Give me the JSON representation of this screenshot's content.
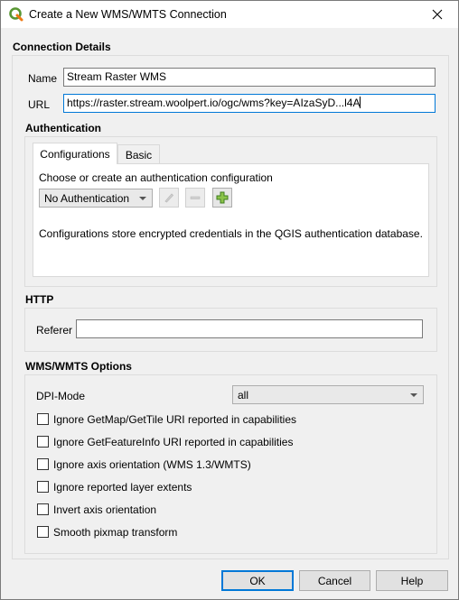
{
  "window": {
    "title": "Create a New WMS/WMTS Connection"
  },
  "connection_details": {
    "section_title": "Connection Details",
    "name_label": "Name",
    "name_value": "Stream Raster WMS",
    "url_label": "URL",
    "url_value": "https://raster.stream.woolpert.io/ogc/wms?key=AIzaSyD...l4A"
  },
  "authentication": {
    "section_title": "Authentication",
    "tabs": [
      "Configurations",
      "Basic"
    ],
    "active_tab": "Configurations",
    "choose_text": "Choose or create an authentication configuration",
    "combo_value": "No Authentication",
    "info_text": "Configurations store encrypted credentials in the QGIS authentication database."
  },
  "http": {
    "section_title": "HTTP",
    "referer_label": "Referer",
    "referer_value": ""
  },
  "wms_options": {
    "section_title": "WMS/WMTS Options",
    "dpi_label": "DPI-Mode",
    "dpi_value": "all",
    "checkboxes": [
      {
        "label": "Ignore GetMap/GetTile URI reported in capabilities",
        "checked": false
      },
      {
        "label": "Ignore GetFeatureInfo URI reported in capabilities",
        "checked": false
      },
      {
        "label": "Ignore axis orientation (WMS 1.3/WMTS)",
        "checked": false
      },
      {
        "label": "Ignore reported layer extents",
        "checked": false
      },
      {
        "label": "Invert axis orientation",
        "checked": false
      },
      {
        "label": "Smooth pixmap transform",
        "checked": false
      }
    ]
  },
  "buttons": {
    "ok": "OK",
    "cancel": "Cancel",
    "help": "Help"
  },
  "colors": {
    "accent": "#0078d7",
    "qgis_green": "#589632",
    "qgis_yellow": "#ee7913"
  }
}
